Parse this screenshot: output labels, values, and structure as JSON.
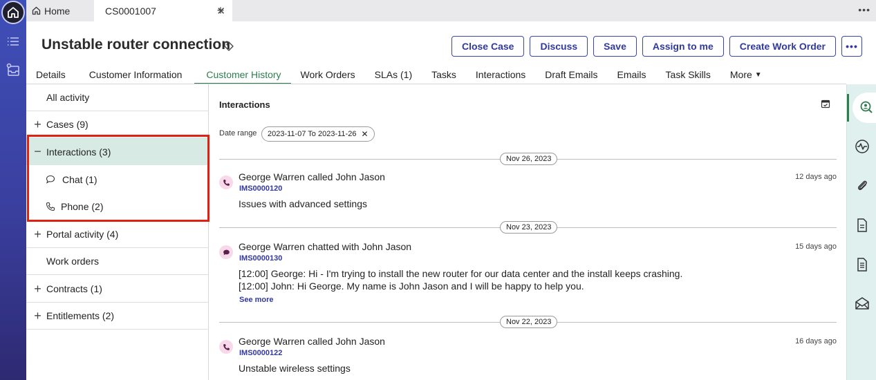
{
  "tabs": {
    "home_label": "Home",
    "case_label": "CS0001007"
  },
  "header": {
    "title": "Unstable router connection",
    "actions": [
      "Close Case",
      "Discuss",
      "Save",
      "Assign to me",
      "Create Work Order"
    ]
  },
  "subnav": {
    "items": [
      "Details",
      "Customer Information",
      "Customer History",
      "Work Orders",
      "SLAs (1)",
      "Tasks",
      "Interactions",
      "Draft Emails",
      "Emails",
      "Task Skills"
    ],
    "more_label": "More",
    "active": "Customer History"
  },
  "history_nav": {
    "all_activity": "All activity",
    "cases": "Cases (9)",
    "interactions": "Interactions (3)",
    "chat": "Chat (1)",
    "phone": "Phone (2)",
    "portal": "Portal activity (4)",
    "work_orders": "Work orders",
    "contracts": "Contracts (1)",
    "entitlements": "Entitlements (2)"
  },
  "main": {
    "section_title": "Interactions",
    "date_range_label": "Date range",
    "date_range_value": "2023-11-07 To 2023-11-26",
    "groups": [
      {
        "date": "Nov 26, 2023",
        "who": "George Warren called John Jason",
        "id": "IMS0000120",
        "ago": "12 days ago",
        "lines": [
          "Issues with advanced settings"
        ],
        "type": "phone"
      },
      {
        "date": "Nov 23, 2023",
        "who": "George Warren chatted with John Jason",
        "id": "IMS0000130",
        "ago": "15 days ago",
        "lines": [
          "[12:00] George: Hi - I'm trying to install the new router for our data center and the install keeps crashing.",
          "[12:00] John: Hi George. My name is John Jason and I will be happy to help you."
        ],
        "see_more": "See more",
        "type": "chat"
      },
      {
        "date": "Nov 22, 2023",
        "who": "George Warren called John Jason",
        "id": "IMS0000122",
        "ago": "16 days ago",
        "lines": [
          "Unstable wireless settings"
        ],
        "type": "phone"
      }
    ]
  },
  "colors": {
    "accent": "#3138a0",
    "active_tab": "#2e7d4f",
    "highlight_box": "#e02010",
    "selected_row": "#d7ebe4"
  }
}
